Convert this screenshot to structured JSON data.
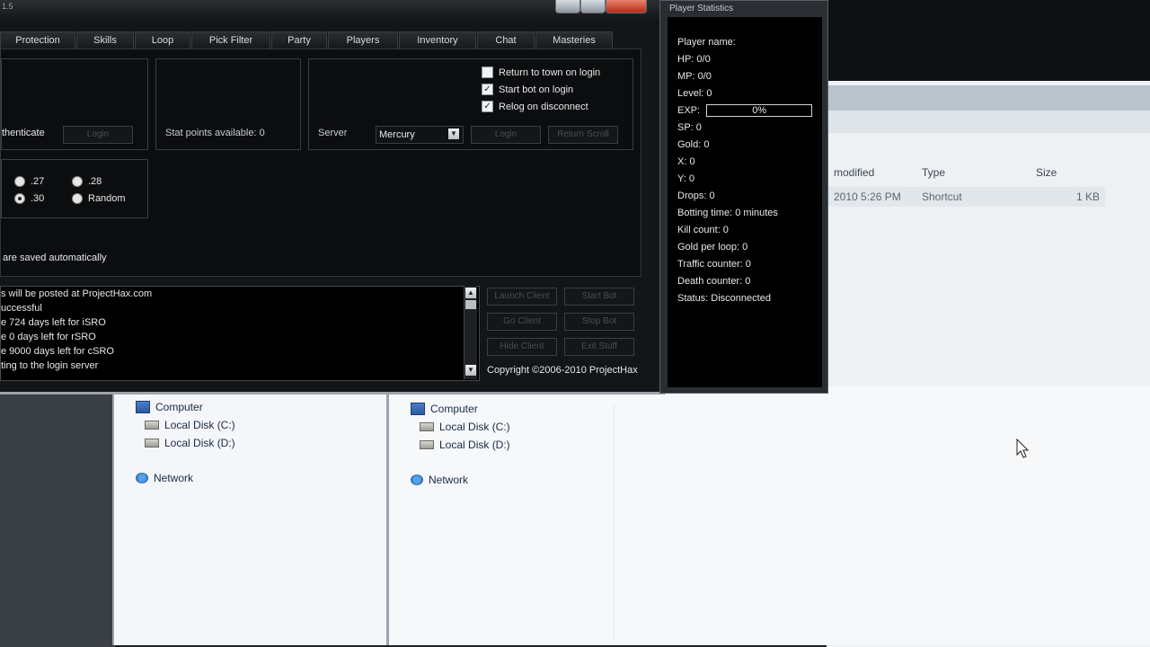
{
  "explorer": {
    "columns": {
      "modified": "modified",
      "type": "Type",
      "size": "Size"
    },
    "file_row": {
      "modified": "2010 5:26 PM",
      "type": "Shortcut",
      "size": "1 KB"
    },
    "tree_left": {
      "computer": "Computer",
      "disk_c": "Local Disk (C:)",
      "disk_d": "Local Disk (D:)",
      "network": "Network"
    },
    "tree_right": {
      "computer": "Computer",
      "disk_c": "Local Disk (C:)",
      "disk_d": "Local Disk (D:)",
      "network": "Network"
    }
  },
  "bot": {
    "title_fragment": "1.5",
    "tabs": [
      "Protection",
      "Skills",
      "Loop",
      "Pick Filter",
      "Party",
      "Players",
      "Inventory",
      "Chat",
      "Masteries"
    ],
    "options": {
      "return_to_town": {
        "label": "Return to town on login",
        "checked": false
      },
      "start_bot": {
        "label": "Start bot on login",
        "checked": true
      },
      "relog": {
        "label": "Relog on disconnect",
        "checked": true
      }
    },
    "authenticate_label": "thenticate",
    "login_button": "Login",
    "stat_points_label": "Stat points available: 0",
    "server_label": "Server",
    "server_value": "Mercury",
    "login_btn2": "Login",
    "return_scroll_btn": "Return Scroll",
    "radios": [
      {
        "label": ".27",
        "selected": false
      },
      {
        "label": ".28",
        "selected": false
      },
      {
        "label": ".30",
        "selected": true
      },
      {
        "label": "Random",
        "selected": false
      }
    ],
    "saved_note": "are saved automatically",
    "log_lines": [
      "s will be posted at ProjectHax.com",
      "uccessful",
      "e 724 days left for iSRO",
      "e 0 days left for rSRO",
      "e 9000 days left for cSRO",
      "ting to the login server"
    ],
    "buttons": {
      "launch_client": "Launch Client",
      "start_bot": "Start Bot",
      "go_client": "Go Client",
      "stop_bot": "Stop Bot",
      "hide_client": "Hide Client",
      "exit_bot": "Exit Stuff"
    },
    "copyright": "Copyright ©2006-2010 ProjectHax"
  },
  "stats": {
    "title": "Player Statistics",
    "lines": [
      "Player name:",
      "HP: 0/0",
      "MP: 0/0",
      "Level: 0"
    ],
    "exp_label": "EXP:",
    "exp_value": "0%",
    "exp_fraction": 0,
    "lines2": [
      "SP: 0",
      "Gold: 0",
      "X: 0",
      "Y: 0",
      "Drops: 0",
      "Botting time: 0 minutes",
      "Kill count: 0",
      "Gold per loop: 0",
      "Traffic counter: 0",
      "Death counter: 0",
      "Status: Disconnected"
    ]
  }
}
